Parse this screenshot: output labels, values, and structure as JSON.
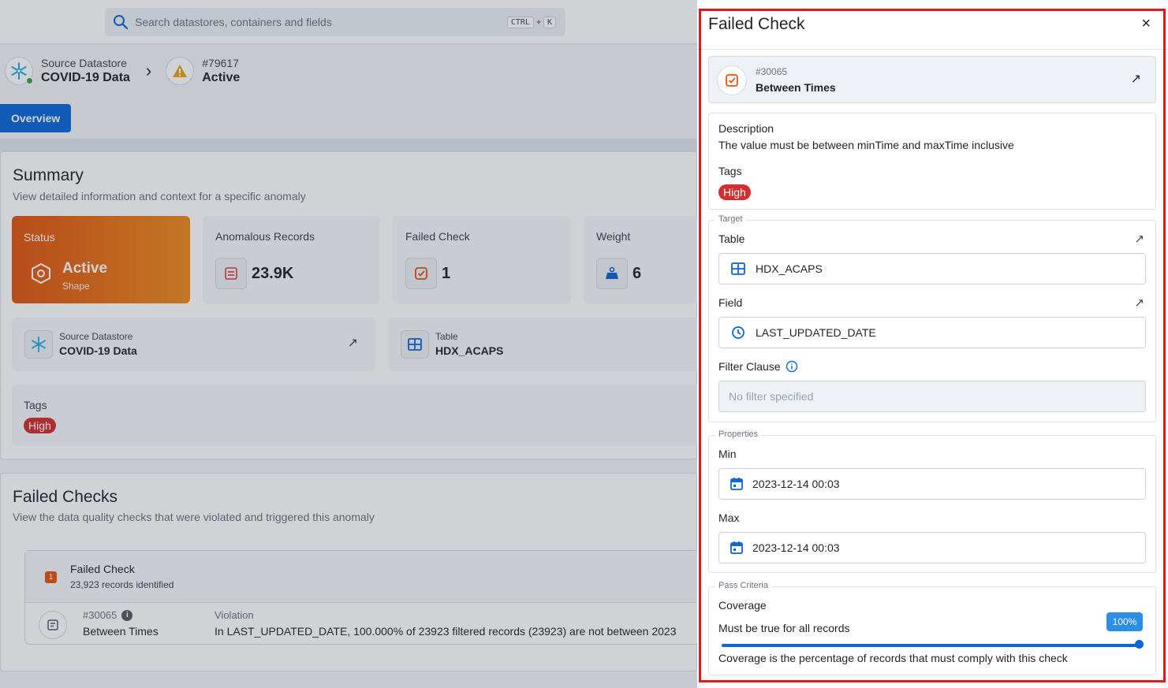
{
  "search": {
    "placeholder": "Search datastores, containers and fields",
    "shortcut_key1": "CTRL",
    "shortcut_plus": "+",
    "shortcut_key2": "K"
  },
  "breadcrumb": {
    "datastore_label": "Source Datastore",
    "datastore_name": "COVID-19 Data",
    "anomaly_id": "#79617",
    "anomaly_status": "Active"
  },
  "tabs": {
    "overview": "Overview"
  },
  "summary": {
    "title": "Summary",
    "subtitle": "View detailed information and context for a specific anomaly",
    "status": {
      "label": "Status",
      "value": "Active",
      "sub": "Shape"
    },
    "anomalous_records": {
      "label": "Anomalous Records",
      "value": "23.9K"
    },
    "failed_check": {
      "label": "Failed Check",
      "value": "1"
    },
    "weight": {
      "label": "Weight",
      "value": "6"
    },
    "source_datastore": {
      "label": "Source Datastore",
      "value": "COVID-19 Data"
    },
    "table": {
      "label": "Table",
      "value": "HDX_ACAPS"
    },
    "tags": {
      "label": "Tags",
      "items": [
        "High"
      ]
    }
  },
  "failed_checks": {
    "title": "Failed Checks",
    "subtitle": "View the data quality checks that were violated and triggered this anomaly",
    "group_count": "1",
    "group_title": "Failed Check",
    "group_sub": "23,923 records identified",
    "row": {
      "id": "#30065",
      "info": "i",
      "name": "Between Times",
      "violation_label": "Violation",
      "violation_text": "In LAST_UPDATED_DATE, 100.000% of 23923 filtered records (23923) are not between 2023"
    }
  },
  "drawer": {
    "title": "Failed Check",
    "close": "×",
    "check": {
      "id": "#30065",
      "name": "Between Times"
    },
    "description_label": "Description",
    "description": "The value must be between minTime and maxTime inclusive",
    "tags_label": "Tags",
    "tags": [
      "High"
    ],
    "target": {
      "legend": "Target",
      "table_label": "Table",
      "table_value": "HDX_ACAPS",
      "field_label": "Field",
      "field_value": "LAST_UPDATED_DATE",
      "filter_label": "Filter Clause",
      "filter_placeholder": "No filter specified"
    },
    "properties": {
      "legend": "Properties",
      "min_label": "Min",
      "min_value": "2023-12-14 00:03",
      "max_label": "Max",
      "max_value": "2023-12-14 00:03"
    },
    "pass_criteria": {
      "legend": "Pass Criteria",
      "coverage_label": "Coverage",
      "coverage_text": "Must be true for all records",
      "coverage_value": "100%",
      "coverage_fraction": 1.0,
      "coverage_help": "Coverage is the percentage of records that must comply with this check"
    }
  },
  "colors": {
    "accent": "#0b66d6",
    "danger": "#d32f2f",
    "status_orange": "#e0540f",
    "highlight_border": "#e5171b"
  },
  "icons": [
    "search-icon",
    "snowflake-icon",
    "warning-icon",
    "chevron-right-icon",
    "shape-icon",
    "records-icon",
    "check-icon",
    "weight-icon",
    "table-icon",
    "arrow-up-right-icon",
    "close-icon",
    "clock-icon",
    "info-icon",
    "calendar-icon"
  ]
}
